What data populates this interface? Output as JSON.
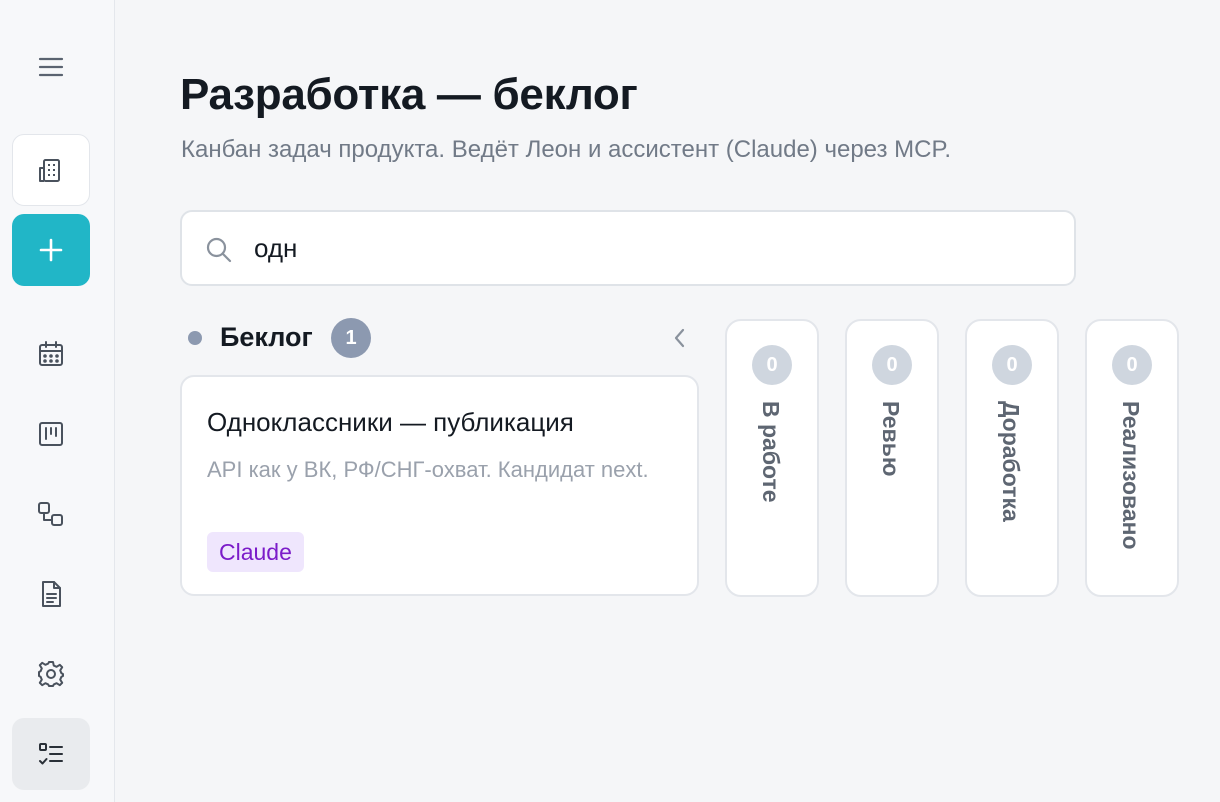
{
  "sidebar": {
    "items": [
      {
        "icon": "menu-icon"
      },
      {
        "icon": "building-icon"
      },
      {
        "icon": "plus-icon"
      },
      {
        "icon": "calendar-icon"
      },
      {
        "icon": "kanban-icon"
      },
      {
        "icon": "workflow-icon"
      },
      {
        "icon": "document-icon"
      },
      {
        "icon": "gear-icon"
      },
      {
        "icon": "tasks-icon"
      }
    ],
    "accent_color": "#21b6c7"
  },
  "header": {
    "title": "Разработка — беклог",
    "subtitle": "Канбан задач продукта. Ведёт Леон и ассистент (Claude) через MCP."
  },
  "search": {
    "value": "одн",
    "icon": "search-icon"
  },
  "board": {
    "open_column": {
      "title": "Беклог",
      "count": "1",
      "dot_color": "#8c99b0",
      "cards": [
        {
          "title": "Одноклассники — публикация",
          "description": "API как у ВК, РФ/СНГ-охват. Кандидат next.",
          "tag": "Claude",
          "tag_color": "#7b1bc9"
        }
      ]
    },
    "collapsed_columns": [
      {
        "label": "В работе",
        "count": "0"
      },
      {
        "label": "Ревью",
        "count": "0"
      },
      {
        "label": "Доработка",
        "count": "0"
      },
      {
        "label": "Реализовано",
        "count": "0"
      }
    ]
  }
}
